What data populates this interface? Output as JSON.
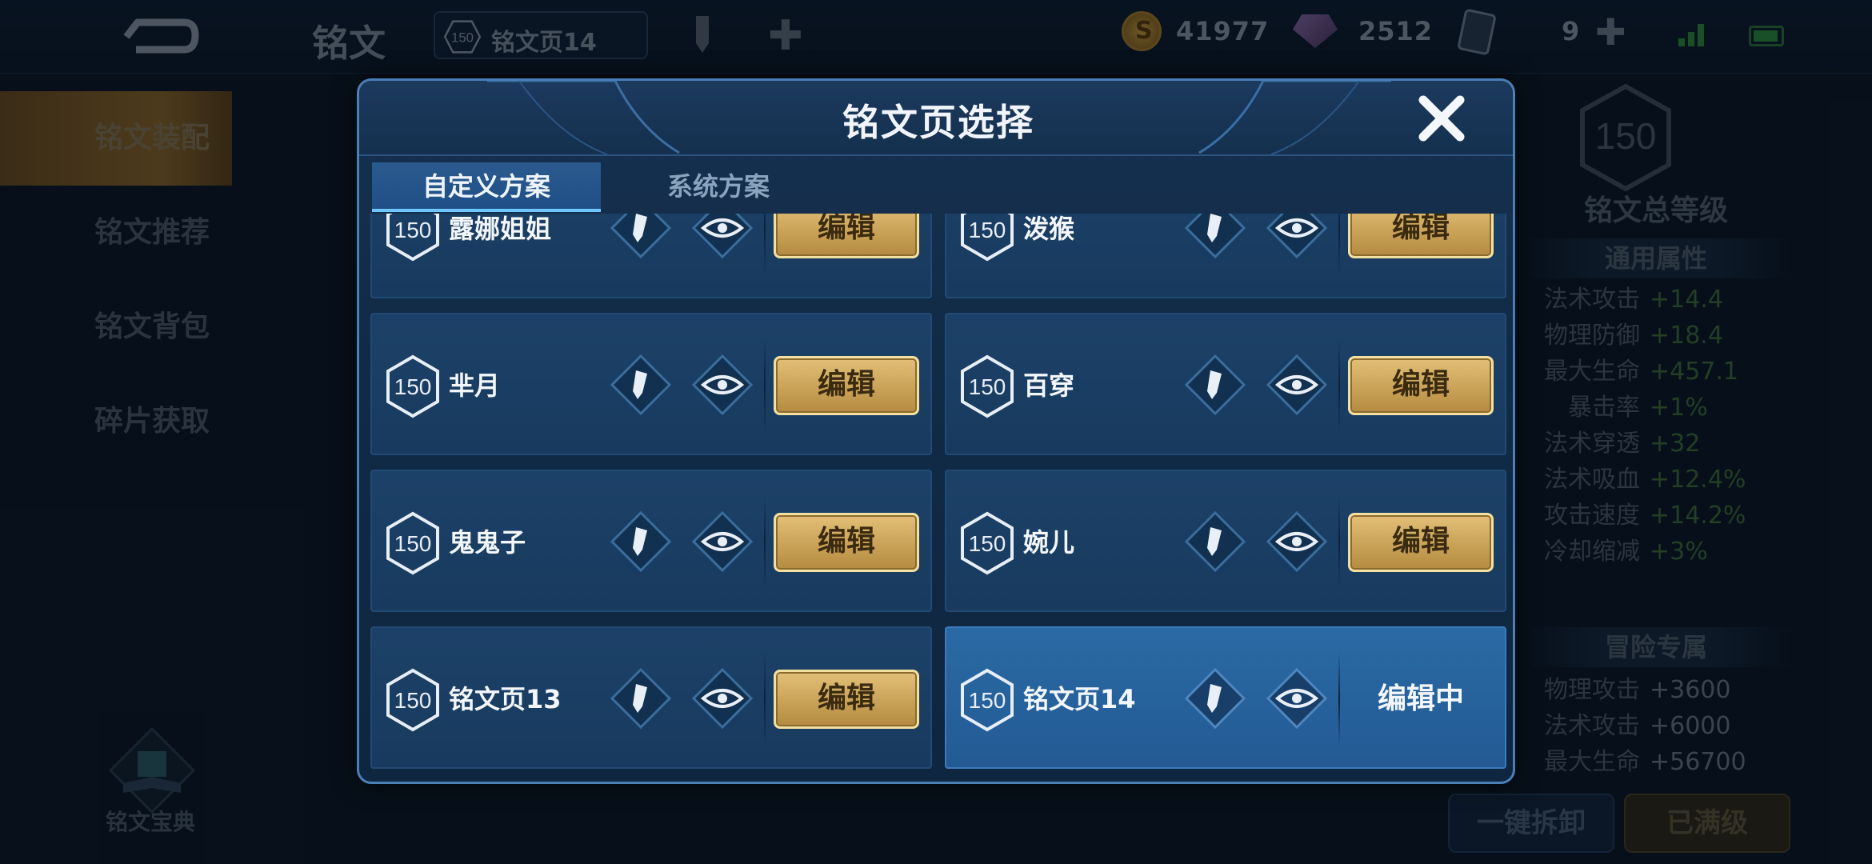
{
  "topbar": {
    "title": "铭文",
    "current_page": {
      "level": "150",
      "name": "铭文页14"
    },
    "coins": "41977",
    "gems": "2512",
    "cards": "9"
  },
  "sidebar": {
    "items": [
      {
        "label": "铭文装配",
        "active": true
      },
      {
        "label": "铭文推荐"
      },
      {
        "label": "铭文背包"
      },
      {
        "label": "碎片获取"
      }
    ],
    "codex_label": "铭文宝典"
  },
  "right_panel": {
    "level": "150",
    "title": "铭文总等级",
    "general_title": "通用属性",
    "general": [
      {
        "k": "法术攻击",
        "v": "+14.4"
      },
      {
        "k": "物理防御",
        "v": "+18.4"
      },
      {
        "k": "最大生命",
        "v": "+457.1"
      },
      {
        "k": "暴击率",
        "v": "+1%"
      },
      {
        "k": "法术穿透",
        "v": "+32"
      },
      {
        "k": "法术吸血",
        "v": "+12.4%"
      },
      {
        "k": "攻击速度",
        "v": "+14.2%"
      },
      {
        "k": "冷却缩减",
        "v": "+3%"
      }
    ],
    "adventure_title": "冒险专属",
    "adventure": [
      {
        "k": "物理攻击",
        "v": "+3600"
      },
      {
        "k": "法术攻击",
        "v": "+6000"
      },
      {
        "k": "最大生命",
        "v": "+56700"
      }
    ],
    "btn_unload": "一键拆卸",
    "btn_full": "已满级"
  },
  "modal": {
    "title": "铭文页选择",
    "tabs": [
      "自定义方案",
      "系统方案"
    ],
    "edit_label": "编辑",
    "editing_label": "编辑中",
    "pages": [
      {
        "level": "150",
        "name": "露娜姐姐"
      },
      {
        "level": "150",
        "name": "泼猴"
      },
      {
        "level": "150",
        "name": "芈月"
      },
      {
        "level": "150",
        "name": "百穿"
      },
      {
        "level": "150",
        "name": "鬼鬼子"
      },
      {
        "level": "150",
        "name": "婉儿"
      },
      {
        "level": "150",
        "name": "铭文页13"
      },
      {
        "level": "150",
        "name": "铭文页14"
      }
    ]
  }
}
